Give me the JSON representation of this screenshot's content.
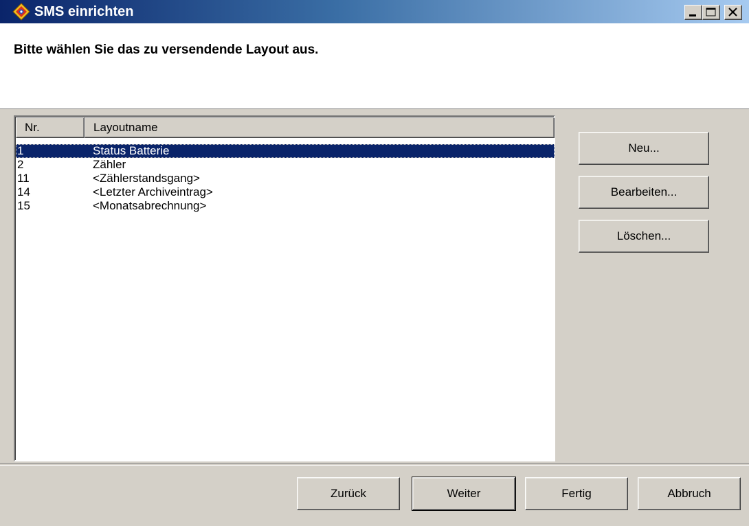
{
  "window": {
    "title": "SMS einrichten",
    "icon": "colorful-diamond-app-icon",
    "controls": [
      "minimize",
      "maximize",
      "close"
    ]
  },
  "header": {
    "instruction": "Bitte wählen Sie das zu versendende Layout aus."
  },
  "layout_list": {
    "columns": [
      "Nr.",
      "Layoutname"
    ],
    "rows": [
      {
        "nr": "1",
        "name": "Status Batterie",
        "selected": true
      },
      {
        "nr": "2",
        "name": "Zähler",
        "selected": false
      },
      {
        "nr": "11",
        "name": "<Zählerstandsgang>",
        "selected": false
      },
      {
        "nr": "14",
        "name": "<Letzter Archiveintrag>",
        "selected": false
      },
      {
        "nr": "15",
        "name": "<Monatsabrechnung>",
        "selected": false
      }
    ]
  },
  "side_buttons": {
    "new": "Neu...",
    "edit": "Bearbeiten...",
    "delete": "Löschen..."
  },
  "footer_buttons": {
    "back": "Zurück",
    "next": "Weiter",
    "finish": "Fertig",
    "cancel": "Abbruch"
  },
  "colors": {
    "title_bar_start": "#0a246a",
    "title_bar_end": "#a6caf0",
    "selection": "#0a246a",
    "face": "#d4d0c8"
  }
}
